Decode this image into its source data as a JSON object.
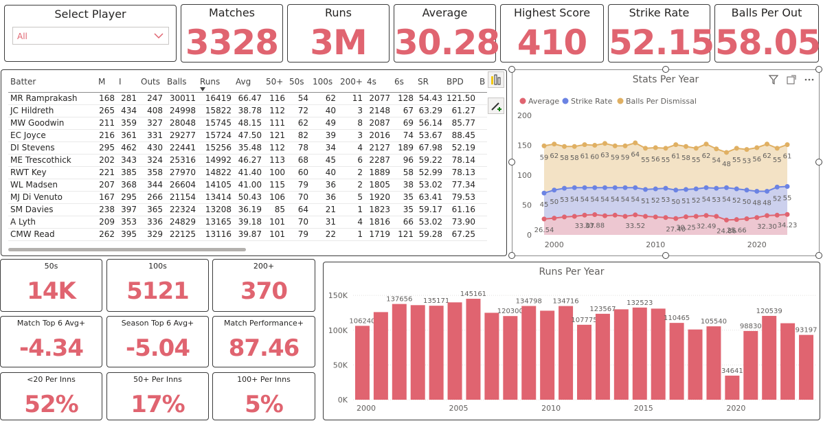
{
  "slicer": {
    "title": "Select Player",
    "value": "All"
  },
  "kpis": [
    {
      "title": "Matches",
      "value": "3328"
    },
    {
      "title": "Runs",
      "value": "3M"
    },
    {
      "title": "Average",
      "value": "30.28"
    },
    {
      "title": "Highest Score",
      "value": "410"
    },
    {
      "title": "Strike Rate",
      "value": "52.15"
    },
    {
      "title": "Balls Per Out",
      "value": "58.05"
    }
  ],
  "small_kpis": [
    {
      "title": "50s",
      "value": "14K"
    },
    {
      "title": "100s",
      "value": "5121"
    },
    {
      "title": "200+",
      "value": "370"
    },
    {
      "title": "Match Top 6 Avg+",
      "value": "-4.34"
    },
    {
      "title": "Season Top 6 Avg+",
      "value": "-5.04"
    },
    {
      "title": "Match Performance+",
      "value": "87.46"
    },
    {
      "title": "<20 Per Inns",
      "value": "52%"
    },
    {
      "title": "50+ Per Inns",
      "value": "17%"
    },
    {
      "title": "100+ Per Inns",
      "value": "5%"
    }
  ],
  "table": {
    "columns": [
      "Batter",
      "M",
      "I",
      "Outs",
      "Balls",
      "Runs",
      "Avg",
      "50+",
      "50s",
      "100s",
      "200+",
      "4s",
      "6s",
      "SR",
      "BPD",
      "B"
    ],
    "rows": [
      [
        "MR Ramprakash",
        "168",
        "281",
        "247",
        "30011",
        "16419",
        "66.47",
        "116",
        "54",
        "62",
        "11",
        "2077",
        "128",
        "54.43",
        "121.50"
      ],
      [
        "JC Hildreth",
        "265",
        "434",
        "408",
        "24998",
        "15822",
        "38.78",
        "112",
        "72",
        "40",
        "3",
        "2148",
        "67",
        "63.29",
        "61.27"
      ],
      [
        "MW Goodwin",
        "211",
        "359",
        "327",
        "28048",
        "15745",
        "48.15",
        "111",
        "62",
        "49",
        "8",
        "2087",
        "69",
        "56.14",
        "85.77"
      ],
      [
        "EC Joyce",
        "216",
        "361",
        "331",
        "29277",
        "15724",
        "47.50",
        "121",
        "82",
        "39",
        "3",
        "2016",
        "74",
        "53.67",
        "88.45"
      ],
      [
        "DI Stevens",
        "295",
        "462",
        "430",
        "22441",
        "15256",
        "35.48",
        "112",
        "78",
        "34",
        "4",
        "2127",
        "189",
        "67.98",
        "52.19"
      ],
      [
        "ME Trescothick",
        "202",
        "343",
        "324",
        "25316",
        "14992",
        "46.27",
        "113",
        "68",
        "45",
        "6",
        "2287",
        "96",
        "59.22",
        "78.14"
      ],
      [
        "RWT Key",
        "221",
        "385",
        "358",
        "27970",
        "14822",
        "41.40",
        "100",
        "60",
        "40",
        "2",
        "1889",
        "58",
        "52.99",
        "78.13"
      ],
      [
        "WL Madsen",
        "207",
        "368",
        "344",
        "26604",
        "14105",
        "41.00",
        "115",
        "79",
        "36",
        "2",
        "1805",
        "38",
        "53.02",
        "77.34"
      ],
      [
        "MJ Di Venuto",
        "167",
        "295",
        "266",
        "21154",
        "13414",
        "50.43",
        "106",
        "70",
        "36",
        "5",
        "1920",
        "35",
        "63.41",
        "79.53"
      ],
      [
        "SM Davies",
        "238",
        "397",
        "365",
        "22324",
        "13208",
        "36.19",
        "85",
        "64",
        "21",
        "1",
        "1823",
        "35",
        "59.17",
        "61.16"
      ],
      [
        "A Lyth",
        "209",
        "353",
        "336",
        "24829",
        "13165",
        "39.18",
        "101",
        "70",
        "31",
        "4",
        "1816",
        "66",
        "53.02",
        "73.90"
      ],
      [
        "CMW Read",
        "262",
        "395",
        "329",
        "22125",
        "13116",
        "39.87",
        "101",
        "79",
        "22",
        "1",
        "1719",
        "121",
        "59.28",
        "67.25"
      ]
    ]
  },
  "stats_chart": {
    "title": "Stats Per Year",
    "legend": [
      "Average",
      "Strike Rate",
      "Balls Per Dismissal"
    ],
    "y_ticks": [
      "0",
      "50",
      "100",
      "150",
      "200"
    ],
    "x_ticks": [
      "2000",
      "2010",
      "2020"
    ],
    "avg_labels": [
      "26.54",
      "33.07",
      "33.88",
      "33.52",
      "27.40",
      "30.25",
      "32.49",
      "24.86",
      "25.66",
      "32.30",
      "34.23"
    ],
    "sr_labels": [
      "45",
      "50",
      "53",
      "54",
      "54",
      "54",
      "54",
      "54",
      "54",
      "54",
      "51",
      "52",
      "53",
      "50",
      "51",
      "52",
      "54",
      "53",
      "54",
      "52",
      "50",
      "48",
      "48",
      "52",
      "55",
      "56"
    ],
    "bpd_labels": [
      "59",
      "62",
      "58",
      "58",
      "61",
      "60",
      "63",
      "59",
      "59",
      "64",
      "55",
      "56",
      "55",
      "61",
      "58",
      "55",
      "62",
      "54",
      "48",
      "55",
      "53",
      "56",
      "62",
      "55",
      "61"
    ]
  },
  "runs_chart": {
    "title": "Runs Per Year",
    "y_ticks": [
      "0K",
      "50K",
      "100K",
      "150K"
    ],
    "x_ticks": [
      "2000",
      "2005",
      "2010",
      "2015",
      "2020"
    ]
  },
  "chart_data": [
    {
      "type": "line",
      "title": "Stats Per Year",
      "x": [
        1999,
        2000,
        2001,
        2002,
        2003,
        2004,
        2005,
        2006,
        2007,
        2008,
        2009,
        2010,
        2011,
        2012,
        2013,
        2014,
        2015,
        2016,
        2017,
        2018,
        2019,
        2020,
        2021,
        2022,
        2023
      ],
      "ylim": [
        0,
        200
      ],
      "series": [
        {
          "name": "Average",
          "color": "#e06470",
          "values": [
            26.54,
            28,
            30,
            31,
            33.07,
            33.88,
            32,
            33,
            31,
            33.52,
            31,
            30,
            29,
            27.4,
            30.25,
            31,
            32.49,
            31,
            24.86,
            25.66,
            27,
            29,
            32.3,
            33,
            34.23
          ]
        },
        {
          "name": "Strike Rate",
          "color": "#6b83e3",
          "values": [
            45,
            50,
            53,
            54,
            54,
            54,
            54,
            54,
            54,
            54,
            51,
            52,
            53,
            50,
            51,
            52,
            54,
            53,
            54,
            52,
            50,
            48,
            48,
            55,
            56
          ]
        },
        {
          "name": "Balls Per Dismissal",
          "color": "#e0b063",
          "values": [
            59,
            62,
            58,
            58,
            61,
            60,
            63,
            59,
            59,
            64,
            55,
            56,
            55,
            61,
            58,
            55,
            62,
            54,
            48,
            55,
            53,
            56,
            62,
            55,
            61
          ]
        }
      ]
    },
    {
      "type": "bar",
      "title": "Runs Per Year",
      "categories": [
        "2000",
        "2001",
        "2002",
        "2003",
        "2004",
        "2005",
        "2006",
        "2007",
        "2008",
        "2009",
        "2010",
        "2011",
        "2012",
        "2013",
        "2014",
        "2015",
        "2016",
        "2017",
        "2018",
        "2019",
        "2020",
        "2021",
        "2022",
        "2023"
      ],
      "values": [
        106240,
        126000,
        137656,
        136000,
        135171,
        140000,
        145161,
        125000,
        120300,
        134798,
        128000,
        134716,
        107775,
        123567,
        130000,
        132523,
        131000,
        110465,
        101000,
        105540,
        34641,
        98830,
        120539,
        110000,
        93197
      ],
      "labels": [
        "106240",
        "",
        "137656",
        "",
        "135171",
        "",
        "145161",
        "",
        "120300",
        "134798",
        "",
        "134716",
        "107775",
        "123567",
        "",
        "132523",
        "",
        "110465",
        "",
        "105540",
        "34641",
        "98830",
        "120539",
        "",
        "93197"
      ],
      "ylim": [
        0,
        160000
      ],
      "color": "#e06470"
    }
  ]
}
